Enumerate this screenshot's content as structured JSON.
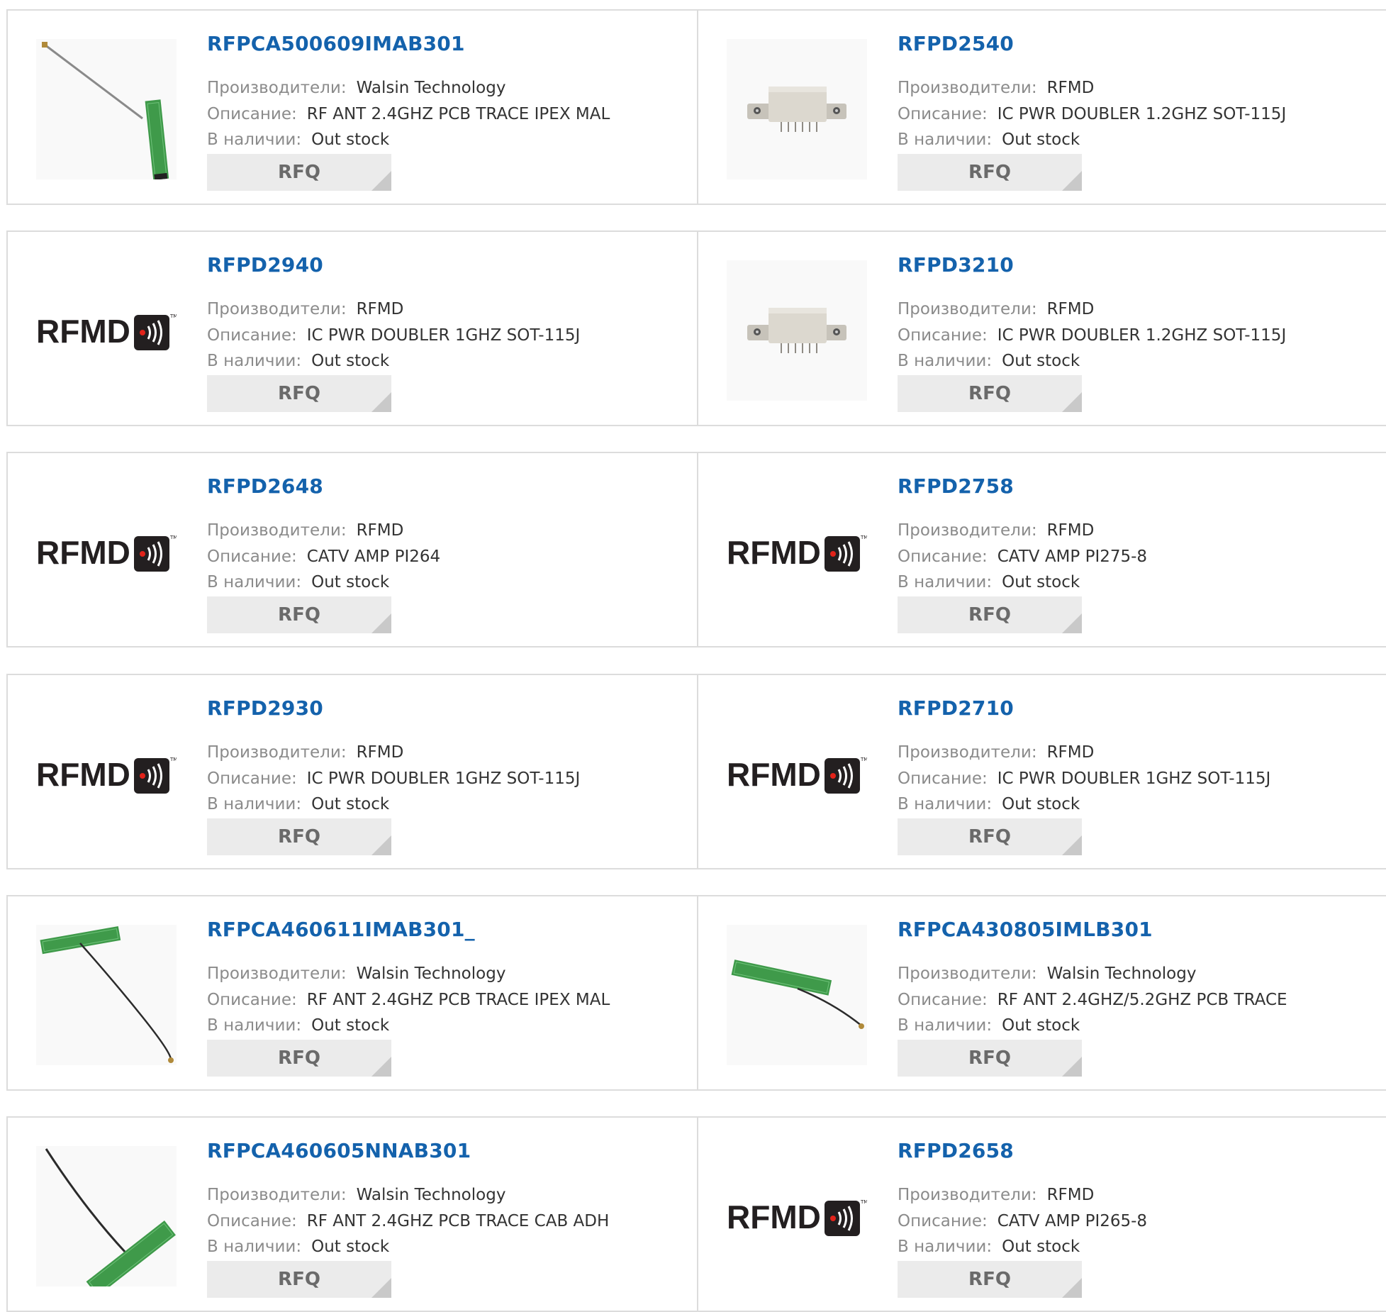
{
  "labels": {
    "manufacturer": "Производители:",
    "description": "Описание:",
    "stock": "В наличии:",
    "rfq": "RFQ"
  },
  "colors": {
    "part_link": "#1462ac",
    "label_gray": "#8b8b8b",
    "value_text": "#333333",
    "button_bg": "#ebebeb",
    "border": "#dcdcdc",
    "pcb_green": "#3f9a4a"
  },
  "logo_text": "RFMD",
  "products": [
    {
      "part": "RFPCA500609IMAB301",
      "manufacturer": "Walsin Technology",
      "description": "RF ANT 2.4GHZ PCB TRACE IPEX MAL",
      "stock": "Out stock",
      "image": "antenna-diagonal-green-end"
    },
    {
      "part": "RFPD2540",
      "manufacturer": "RFMD",
      "description": "IC PWR DOUBLER 1.2GHZ SOT-115J",
      "stock": "Out stock",
      "image": "module"
    },
    {
      "part": "RFPD2940",
      "manufacturer": "RFMD",
      "description": "IC PWR DOUBLER 1GHZ SOT-115J",
      "stock": "Out stock",
      "image": "rfmd-logo"
    },
    {
      "part": "RFPD3210",
      "manufacturer": "RFMD",
      "description": "IC PWR DOUBLER 1.2GHZ SOT-115J",
      "stock": "Out stock",
      "image": "module"
    },
    {
      "part": "RFPD2648",
      "manufacturer": "RFMD",
      "description": "CATV AMP PI264",
      "stock": "Out stock",
      "image": "rfmd-logo"
    },
    {
      "part": "RFPD2758",
      "manufacturer": "RFMD",
      "description": "CATV AMP PI275-8",
      "stock": "Out stock",
      "image": "rfmd-logo"
    },
    {
      "part": "RFPD2930",
      "manufacturer": "RFMD",
      "description": "IC PWR DOUBLER 1GHZ SOT-115J",
      "stock": "Out stock",
      "image": "rfmd-logo"
    },
    {
      "part": "RFPD2710",
      "manufacturer": "RFMD",
      "description": "IC PWR DOUBLER 1GHZ SOT-115J",
      "stock": "Out stock",
      "image": "rfmd-logo"
    },
    {
      "part": "RFPCA460611IMAB301_",
      "manufacturer": "Walsin Technology",
      "description": "RF ANT 2.4GHZ PCB TRACE IPEX MAL",
      "stock": "Out stock",
      "image": "antenna-t-top"
    },
    {
      "part": "RFPCA430805IMLB301",
      "manufacturer": "Walsin Technology",
      "description": "RF ANT 2.4GHZ/5.2GHZ PCB TRACE",
      "stock": "Out stock",
      "image": "antenna-board-left"
    },
    {
      "part": "RFPCA460605NNAB301",
      "manufacturer": "Walsin Technology",
      "description": "RF ANT 2.4GHZ PCB TRACE CAB ADH",
      "stock": "Out stock",
      "image": "antenna-board-bottom"
    },
    {
      "part": "RFPD2658",
      "manufacturer": "RFMD",
      "description": "CATV AMP PI265-8",
      "stock": "Out stock",
      "image": "rfmd-logo"
    }
  ]
}
